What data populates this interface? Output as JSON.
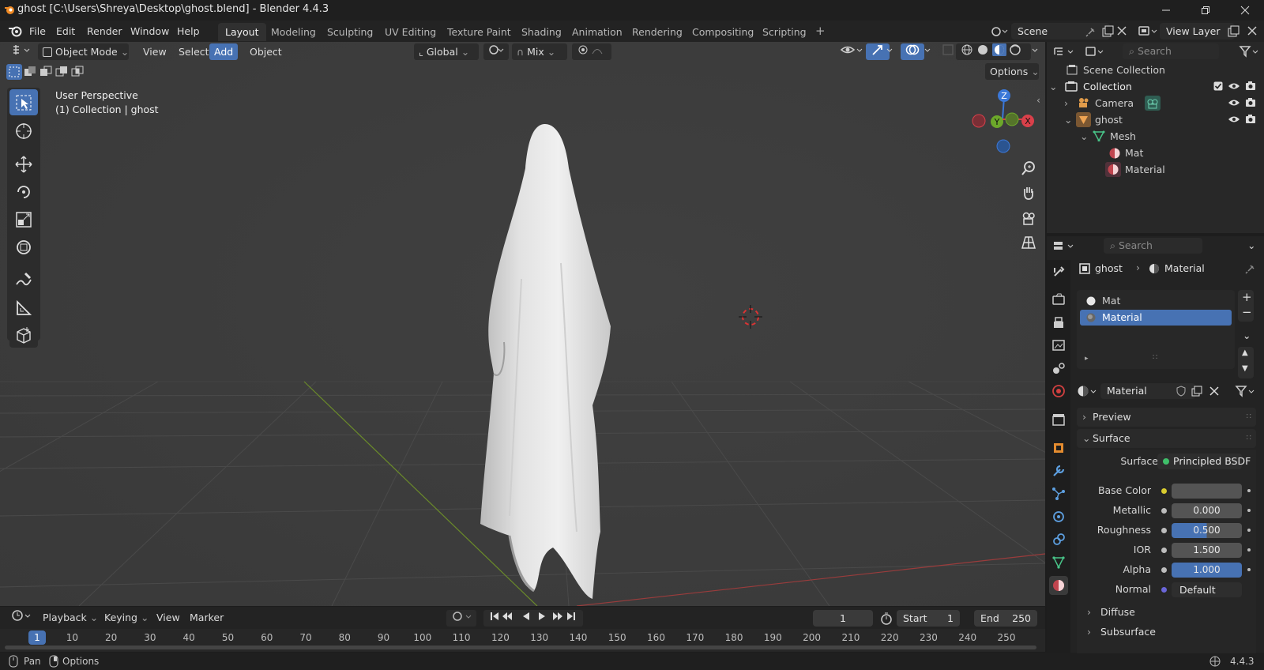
{
  "window": {
    "title": "ghost [C:\\Users\\Shreya\\Desktop\\ghost.blend] - Blender 4.4.3"
  },
  "menu": {
    "items": [
      "File",
      "Edit",
      "Render",
      "Window",
      "Help"
    ]
  },
  "workspaces": [
    "Layout",
    "Modeling",
    "Sculpting",
    "UV Editing",
    "Texture Paint",
    "Shading",
    "Animation",
    "Rendering",
    "Compositing",
    "Scripting"
  ],
  "workspace_add": "+",
  "scene": {
    "label": "Scene",
    "view_layer": "View Layer"
  },
  "viewport": {
    "mode": "Object Mode",
    "menus": [
      "View",
      "Select",
      "Add",
      "Object"
    ],
    "transform": "Global",
    "pivot": "Mix",
    "options": "Options",
    "overlay_title": "User Perspective",
    "overlay_sub": "(1) Collection | ghost",
    "gizmo": {
      "z": "Z",
      "y": "Y",
      "x": "X"
    }
  },
  "outliner": {
    "search_placeholder": "Search",
    "rows": [
      {
        "label": "Scene Collection"
      },
      {
        "label": "Collection"
      },
      {
        "label": "Camera"
      },
      {
        "label": "ghost"
      },
      {
        "label": "Mesh"
      },
      {
        "label": "Mat"
      },
      {
        "label": "Material"
      }
    ]
  },
  "properties": {
    "search_placeholder": "Search",
    "breadcrumb": {
      "object": "ghost",
      "data": "Material"
    },
    "slots": [
      "Mat",
      "Material"
    ],
    "material_name": "Material",
    "panels": {
      "preview": "Preview",
      "surface": "Surface",
      "diffuse": "Diffuse",
      "subsurface": "Subsurface"
    },
    "surface": {
      "label": "Surface",
      "shader": "Principled BSDF"
    },
    "fields": {
      "base_color": {
        "label": "Base Color"
      },
      "metallic": {
        "label": "Metallic",
        "value": "0.000"
      },
      "roughness": {
        "label": "Roughness",
        "value": "0.500"
      },
      "ior": {
        "label": "IOR",
        "value": "1.500"
      },
      "alpha": {
        "label": "Alpha",
        "value": "1.000"
      },
      "normal": {
        "label": "Normal",
        "value": "Default"
      }
    }
  },
  "timeline": {
    "menus": [
      "Playback",
      "Keying",
      "View",
      "Marker"
    ],
    "current_frame": "1",
    "start_label": "Start",
    "start": "1",
    "end_label": "End",
    "end": "250",
    "ruler": [
      "1",
      "10",
      "20",
      "30",
      "40",
      "50",
      "60",
      "70",
      "80",
      "90",
      "100",
      "110",
      "120",
      "130",
      "140",
      "150",
      "160",
      "170",
      "180",
      "190",
      "200",
      "210",
      "220",
      "230",
      "240",
      "250"
    ]
  },
  "status": {
    "pan": "Pan",
    "options": "Options",
    "version": "4.4.3"
  },
  "colors": {
    "accent": "#4772b3",
    "viewport_bg": "#3d3d3d",
    "header_bg": "#232323"
  }
}
